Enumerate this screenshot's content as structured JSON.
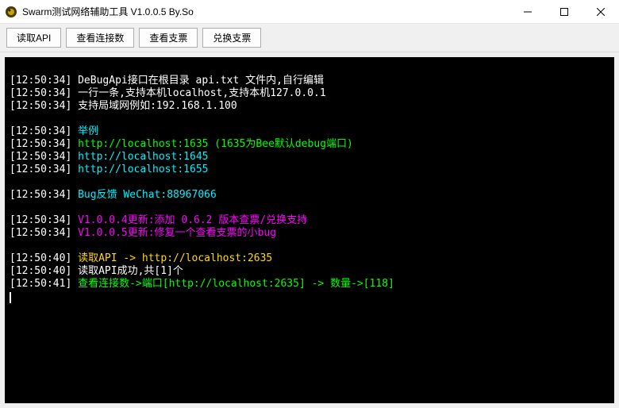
{
  "window": {
    "title": "Swarm测试网络辅助工具 V1.0.0.5 By.So"
  },
  "toolbar": {
    "btn_read_api": "读取API",
    "btn_conn_count": "查看连接数",
    "btn_view_cheque": "查看支票",
    "btn_redeem_cheque": "兑换支票"
  },
  "log": [
    {
      "ts": "[12:50:34]",
      "cls": "c-white",
      "text": " DeBugApi接口在根目录 api.txt 文件内,自行编辑"
    },
    {
      "ts": "[12:50:34]",
      "cls": "c-white",
      "text": " 一行一条,支持本机localhost,支持本机127.0.0.1"
    },
    {
      "ts": "[12:50:34]",
      "cls": "c-white",
      "text": " 支持局域网例如:192.168.1.100"
    },
    {
      "blank": true
    },
    {
      "ts": "[12:50:34]",
      "cls": "c-aqua",
      "text": " 举例"
    },
    {
      "ts": "[12:50:34]",
      "cls": "c-lime",
      "text": " http://localhost:1635 (1635为Bee默认debug端口)"
    },
    {
      "ts": "[12:50:34]",
      "cls": "c-aqua",
      "text": " http://localhost:1645"
    },
    {
      "ts": "[12:50:34]",
      "cls": "c-aqua",
      "text": " http://localhost:1655"
    },
    {
      "blank": true
    },
    {
      "ts": "[12:50:34]",
      "cls": "c-aqua",
      "text": " Bug反馈 WeChat:88967066"
    },
    {
      "blank": true
    },
    {
      "ts": "[12:50:34]",
      "cls": "c-pink",
      "text": " V1.0.0.4更新:添加 0.6.2 版本查票/兑换支持"
    },
    {
      "ts": "[12:50:34]",
      "cls": "c-pink",
      "text": " V1.0.0.5更新:修复一个查看支票的小bug"
    },
    {
      "blank": true
    },
    {
      "ts": "[12:50:40]",
      "cls": "c-gold",
      "text": " 读取API -> http://localhost:2635"
    },
    {
      "ts": "[12:50:40]",
      "cls": "c-white",
      "text": " 读取API成功,共[1]个"
    },
    {
      "ts": "[12:50:41]",
      "cls": "c-lime",
      "text": " 查看连接数->端口[http://localhost:2635] -> 数量->[118]"
    }
  ]
}
